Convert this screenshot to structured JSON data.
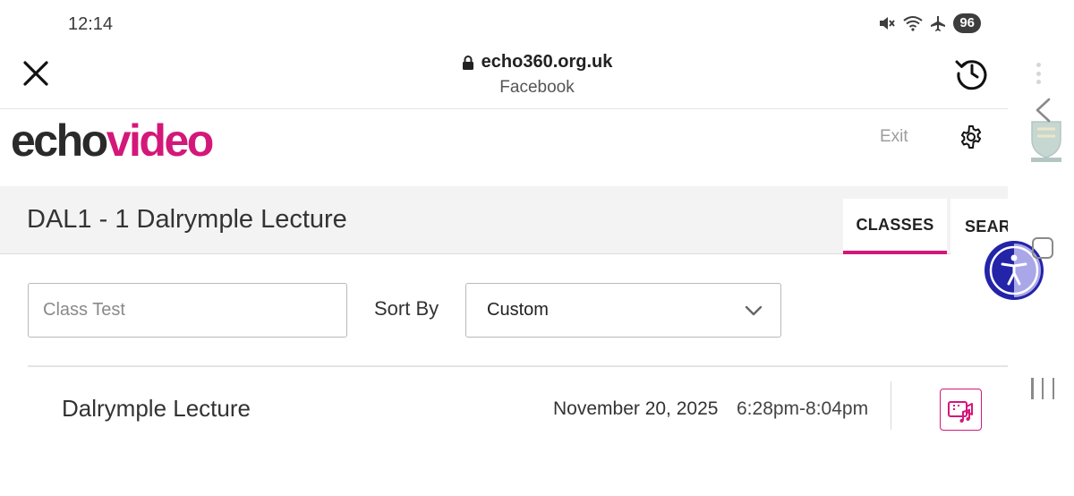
{
  "status_bar": {
    "time": "12:14",
    "battery": "96",
    "icons": [
      "mute-icon",
      "wifi-icon",
      "airplane-icon"
    ]
  },
  "browser": {
    "url": "echo360.org.uk",
    "subtitle": "Facebook"
  },
  "app": {
    "logo_part1": "echo",
    "logo_part2": "video",
    "exit_label": "Exit",
    "accent_color": "#d3187a"
  },
  "course": {
    "title": "DAL1 - 1 Dalrymple Lecture",
    "tabs": [
      {
        "label": "CLASSES",
        "active": true
      },
      {
        "label": "SEARCH",
        "active": false
      }
    ]
  },
  "filters": {
    "class_filter_value": "",
    "class_filter_placeholder": "Class Test",
    "sort_label": "Sort By",
    "sort_value": "Custom"
  },
  "classes": [
    {
      "name": "Dalrymple Lecture",
      "date": "November 20, 2025",
      "time": "6:28pm-8:04pm",
      "media_icon": "video-audio-icon"
    }
  ]
}
